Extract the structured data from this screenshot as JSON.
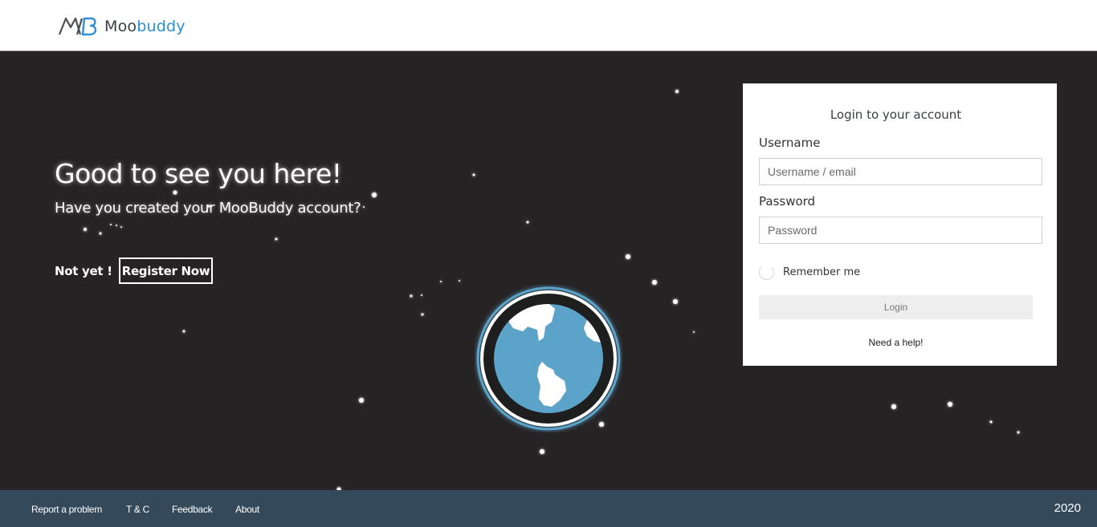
{
  "header": {
    "logo": {
      "part1": "Moo",
      "part2": "buddy",
      "icon": "mb-monogram-logo"
    }
  },
  "hero": {
    "headline": "Good to see you here!",
    "subline": "Have you created your MooBuddy account?",
    "not_yet": "Not yet !",
    "register_label": "Register Now",
    "illustration": "globe-icon"
  },
  "login": {
    "title": "Login to your account",
    "username_label": "Username",
    "username_placeholder": "Username / email",
    "username_value": "",
    "password_label": "Password",
    "password_placeholder": "Password",
    "password_value": "",
    "remember_label": "Remember me",
    "remember_checked": false,
    "login_label": "Login",
    "help_label": "Need a help!"
  },
  "footer": {
    "links": [
      "Report a problem",
      "T & C",
      "Feedback",
      "About"
    ],
    "year": "2020"
  },
  "colors": {
    "background": "#262324",
    "brand_blue": "#2e8fd6",
    "globe_ocean": "#5ba3c9",
    "footer": "#34495a"
  }
}
